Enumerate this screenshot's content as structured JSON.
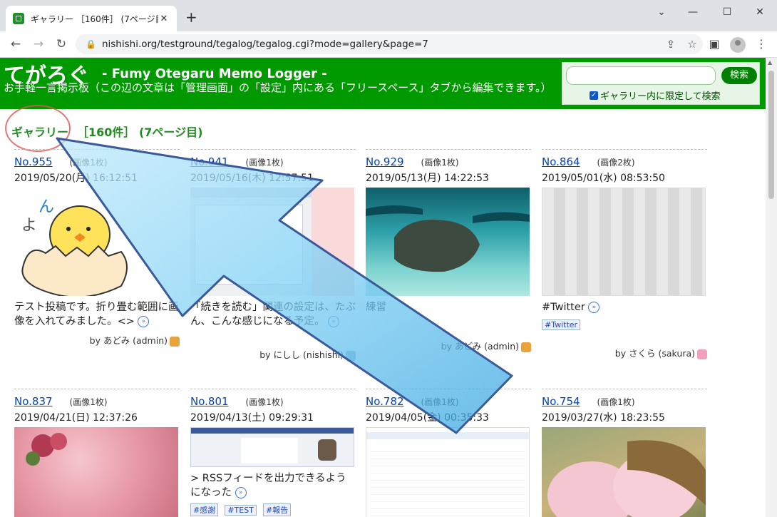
{
  "browser": {
    "tab_title": "ギャラリー ［160件］ (7ページ目)",
    "tab_close": "✕",
    "new_tab": "+",
    "url": "nishishi.org/testground/tegalog/tegalog.cgi?mode=gallery&page=7"
  },
  "header": {
    "logo": "てがろぐ",
    "subtitle": "- Fumy Otegaru Memo Logger -",
    "description": "お手軽一言掲示板（この辺の文章は「管理画面」の「設定」内にある「フリースペース」タブから編集できます。）",
    "search_button": "検索",
    "search_checkbox_label": "ギャラリー内に限定して検索",
    "search_placeholder": ""
  },
  "page_heading": {
    "title": "ギャラリー",
    "count": "［160件］ (7ページ目)"
  },
  "cards": [
    {
      "no": "No.955",
      "imgs": "(画像1枚)",
      "date": "2019/05/20(月) 16:12:51",
      "msg": "テスト投稿です。折り畳む範囲に画像を入れてみました。<>",
      "tags": [],
      "by": "by あどみ (admin)"
    },
    {
      "no": "No.941",
      "imgs": "(画像1枚)",
      "date": "2019/05/16(木) 12:57:51",
      "msg": "「続きを読む」関連の設定は、たぶん、こんな感じになる予定。",
      "tags": [],
      "by": "by にしし (nishishi)"
    },
    {
      "no": "No.929",
      "imgs": "(画像1枚)",
      "date": "2019/05/13(月) 14:22:53",
      "msg": "練習",
      "tags": [],
      "by": "by あどみ (admin)"
    },
    {
      "no": "No.864",
      "imgs": "(画像2枚)",
      "date": "2019/05/01(水) 08:53:50",
      "msg": "#Twitter",
      "tags": [
        "#Twitter"
      ],
      "by": "by さくら (sakura)"
    },
    {
      "no": "No.837",
      "imgs": "(画像1枚)",
      "date": "2019/04/21(日) 12:37:26",
      "msg": "",
      "tags": [],
      "by": ""
    },
    {
      "no": "No.801",
      "imgs": "(画像1枚)",
      "date": "2019/04/13(土) 09:29:31",
      "msg": "> RSSフィードを出力できるようになった",
      "tags": [
        "#感謝",
        "#TEST",
        "#報告"
      ],
      "by": ""
    },
    {
      "no": "No.782",
      "imgs": "(画像1枚)",
      "date": "2019/04/05(金) 00:35:33",
      "msg": "",
      "tags": [],
      "by": ""
    },
    {
      "no": "No.754",
      "imgs": "(画像1枚)",
      "date": "2019/03/27(水) 18:23:55",
      "msg": "",
      "tags": [],
      "by": ""
    }
  ],
  "more_glyph": "»",
  "colors": {
    "header_green": "#009900",
    "link": "#0645ad",
    "arrow": "#7fd0f5"
  }
}
